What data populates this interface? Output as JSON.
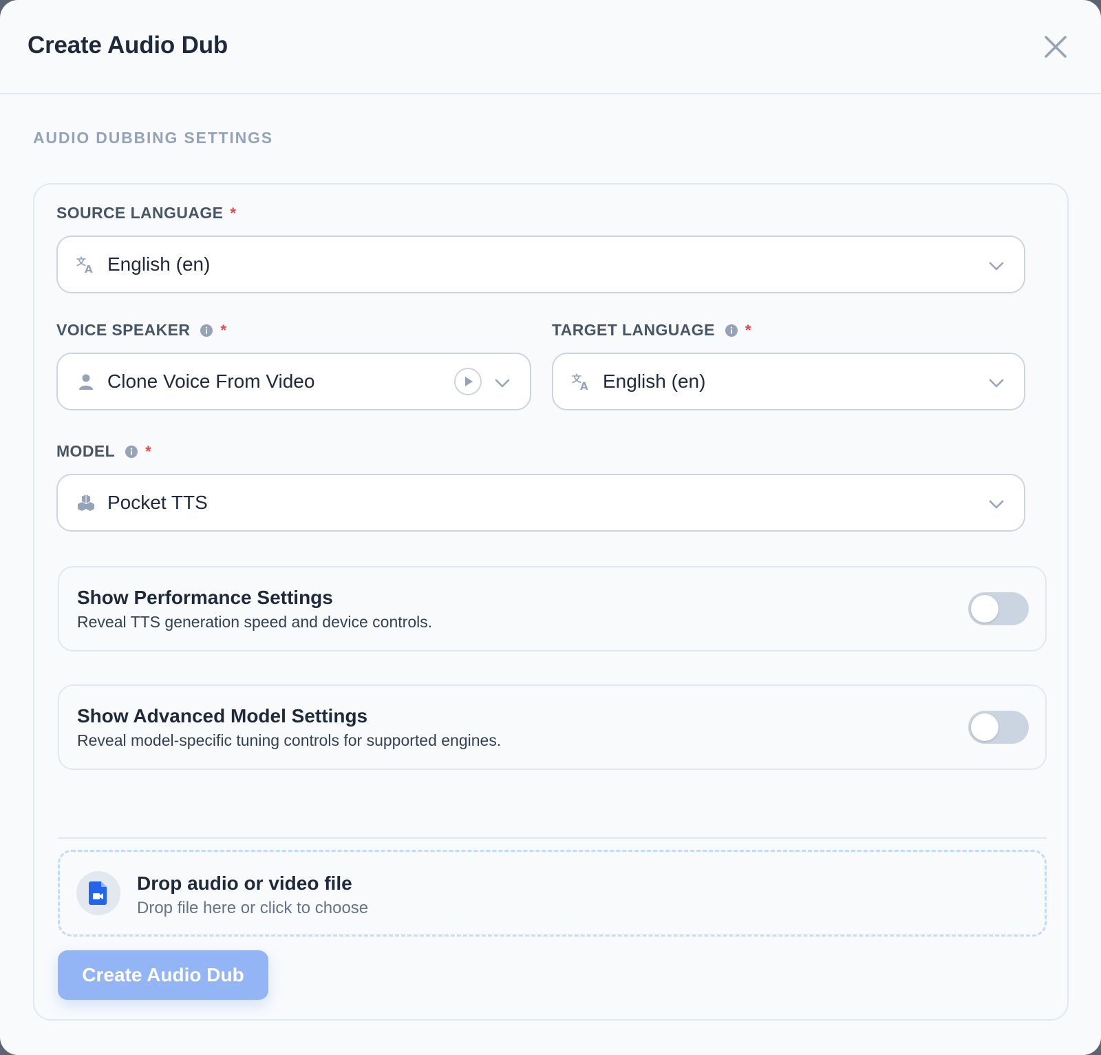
{
  "header": {
    "title": "Create Audio Dub",
    "close_icon": "close-icon"
  },
  "section": {
    "heading": "AUDIO DUBBING SETTINGS"
  },
  "fields": {
    "source_language": {
      "label": "SOURCE LANGUAGE",
      "required_mark": "*",
      "value": "English (en)",
      "icon": "translate-icon"
    },
    "voice_speaker": {
      "label": "VOICE SPEAKER",
      "required_mark": "*",
      "value": "Clone Voice From Video",
      "icon": "user-icon"
    },
    "target_language": {
      "label": "TARGET LANGUAGE",
      "required_mark": "*",
      "value": "English (en)",
      "icon": "translate-icon"
    },
    "model": {
      "label": "MODEL",
      "required_mark": "*",
      "value": "Pocket TTS",
      "icon": "cubes-icon"
    }
  },
  "toggles": {
    "performance": {
      "title": "Show Performance Settings",
      "description": "Reveal TTS generation speed and device controls.",
      "enabled": false
    },
    "advanced": {
      "title": "Show Advanced Model Settings",
      "description": "Reveal model-specific tuning controls for supported engines.",
      "enabled": false
    }
  },
  "dropzone": {
    "title": "Drop audio or video file",
    "subtitle": "Drop file here or click to choose",
    "icon": "file-video-icon"
  },
  "submit": {
    "label": "Create Audio Dub"
  },
  "colors": {
    "accent": "#93b4f5",
    "required": "#ef4444",
    "file_icon": "#2563eb",
    "background": "#f8fafc",
    "border": "#cbd5e1"
  }
}
